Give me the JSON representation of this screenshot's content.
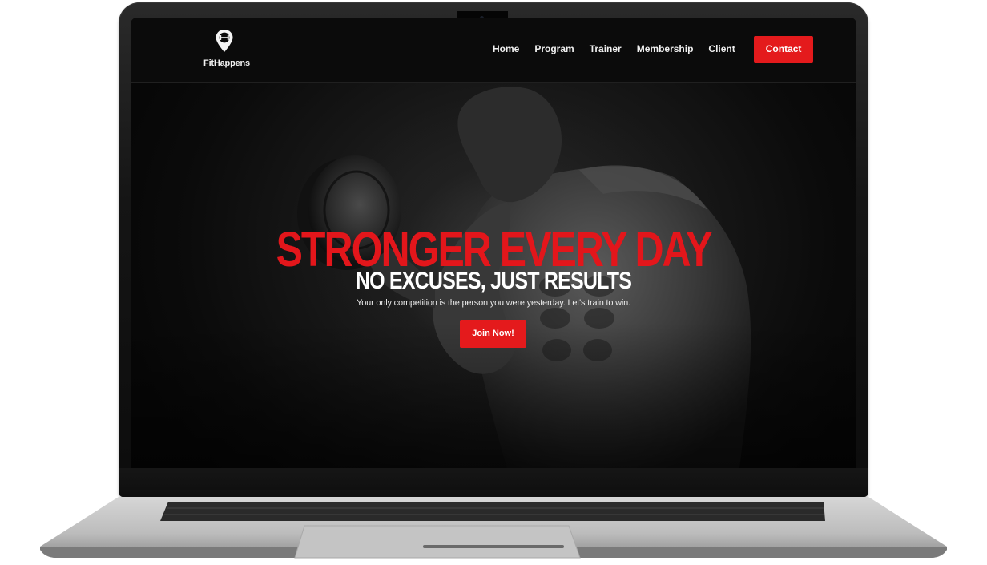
{
  "site": {
    "logo_text": "FitHappens"
  },
  "nav": {
    "items": [
      "Home",
      "Program",
      "Trainer",
      "Membership",
      "Client"
    ],
    "contact_label": "Contact"
  },
  "hero": {
    "title": "STRONGER EVERY DAY",
    "subtitle": "NO EXCUSES, JUST RESULTS",
    "tagline": "Your only competition is the person you were yesterday. Let's train to win.",
    "cta_label": "Join Now!"
  },
  "colors": {
    "accent": "#e41a1c",
    "header_bg": "#0b0b0b",
    "hero_bg": "#1a1a1a",
    "text": "#ffffff"
  },
  "icons": {
    "logo": "map-pin-dumbbell-icon"
  }
}
